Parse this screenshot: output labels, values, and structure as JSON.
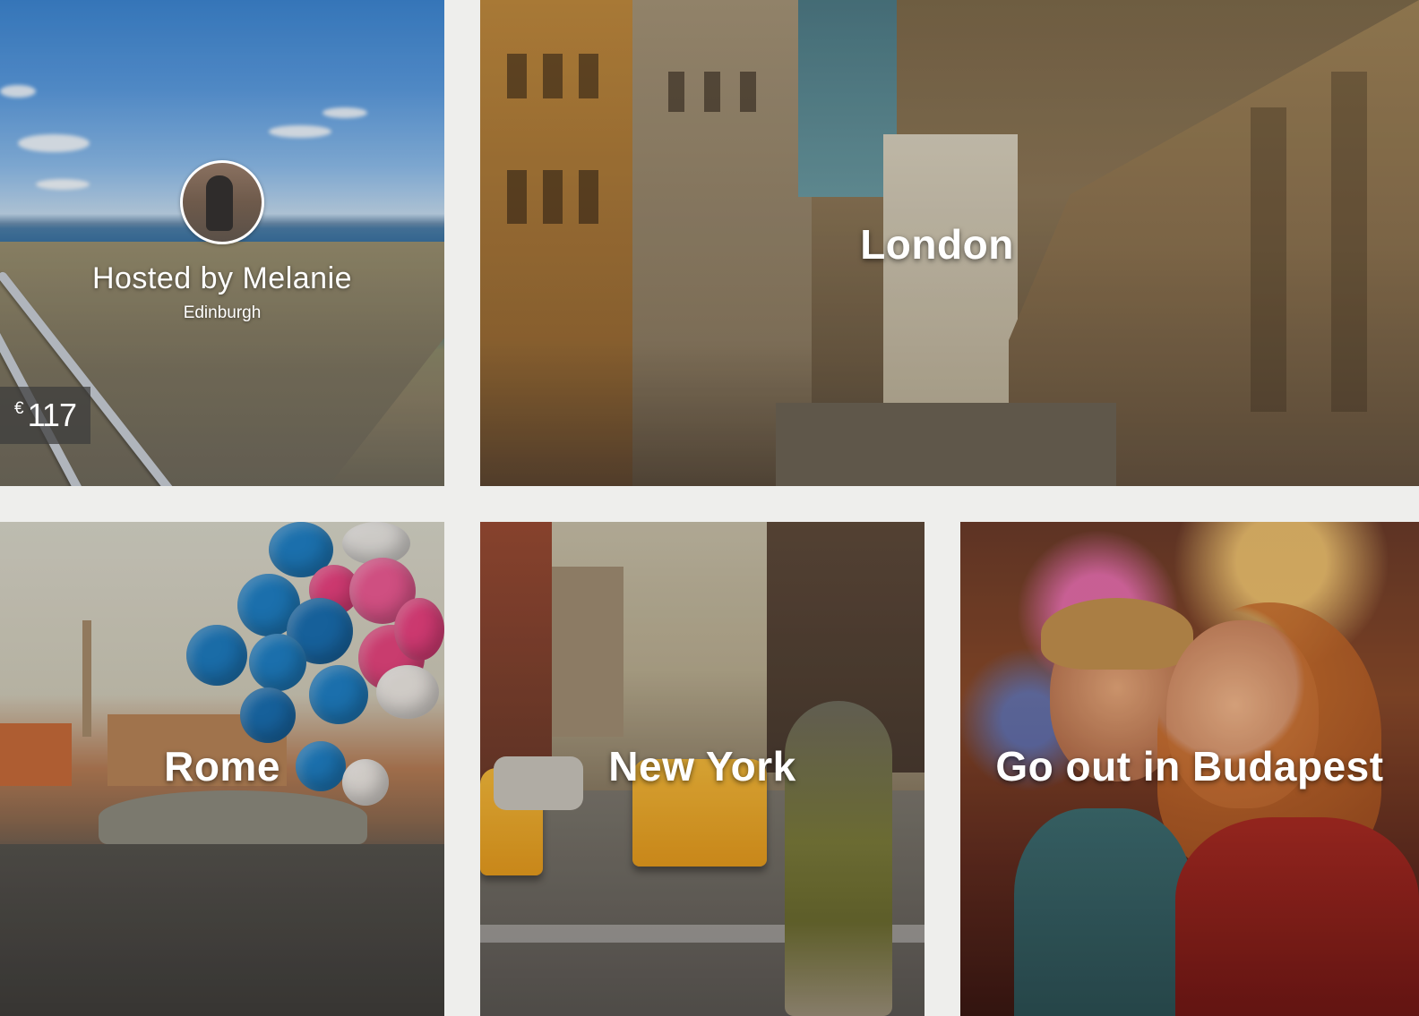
{
  "host_card": {
    "host_name": "Hosted by Melanie",
    "city": "Edinburgh",
    "price_currency": "€",
    "price_amount": "117"
  },
  "destinations": [
    {
      "title": "London"
    },
    {
      "title": "Rome"
    },
    {
      "title": "New York"
    },
    {
      "title": "Go out in Budapest"
    }
  ],
  "colors": {
    "background": "#eeeeec",
    "title_text": "#ffffff",
    "price_badge": "#3c3c3c"
  },
  "icons": {
    "avatar": "host-avatar"
  }
}
